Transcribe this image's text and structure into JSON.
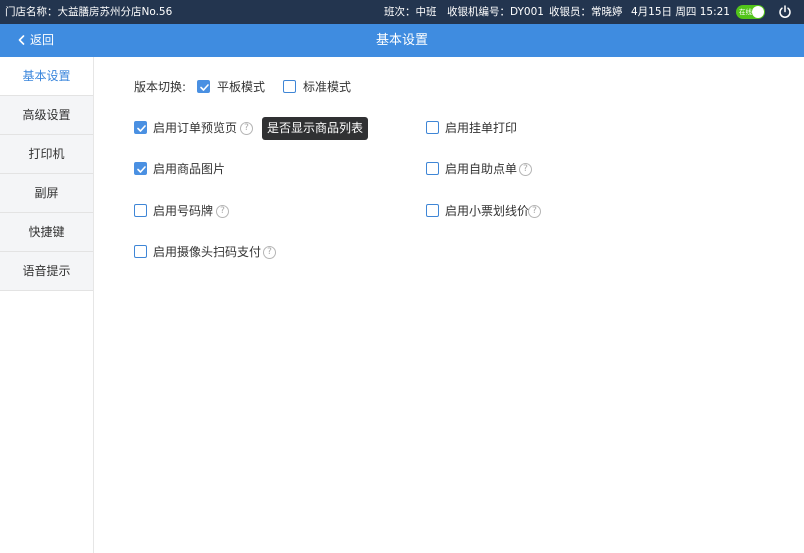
{
  "status_bar": {
    "store_name": "门店名称：大益膳房苏州分店No.56",
    "shift": "班次：中班",
    "register": "收银机编号：DY001",
    "cashier": "收银员：常晓婷",
    "datetime": "4月15日  周四  15:21",
    "online_label": "在线",
    "online": true
  },
  "nav": {
    "back_label": "返回",
    "title": "基本设置"
  },
  "sidebar": {
    "items": [
      {
        "label": "基本设置",
        "active": true
      },
      {
        "label": "高级设置",
        "active": false
      },
      {
        "label": "打印机",
        "active": false
      },
      {
        "label": "副屏",
        "active": false
      },
      {
        "label": "快捷键",
        "active": false
      },
      {
        "label": "语音提示",
        "active": false
      }
    ]
  },
  "settings": {
    "version_label": "版本切换:",
    "tablet_mode": {
      "label": "平板模式",
      "checked": true
    },
    "standard_mode": {
      "label": "标准模式",
      "checked": false
    },
    "order_preview": {
      "label": "启用订单预览页",
      "checked": true
    },
    "hang_print": {
      "label": "启用挂单打印",
      "checked": false
    },
    "product_image": {
      "label": "启用商品图片",
      "checked": true
    },
    "self_order": {
      "label": "启用自助点单",
      "checked": false
    },
    "number_plate": {
      "label": "启用号码牌",
      "checked": false
    },
    "strike_price": {
      "label": "启用小票划线价",
      "checked": false
    },
    "camera_pay": {
      "label": "启用摄像头扫码支付",
      "checked": false
    },
    "help_glyph": "?"
  },
  "tooltip": {
    "text": "是否显示商品列表"
  },
  "colors": {
    "status_bar_bg": "#23354f",
    "nav_bg": "#3f8ce0",
    "accent": "#4a90e2",
    "online_green": "#52c41a",
    "tooltip_bg": "#303133"
  }
}
